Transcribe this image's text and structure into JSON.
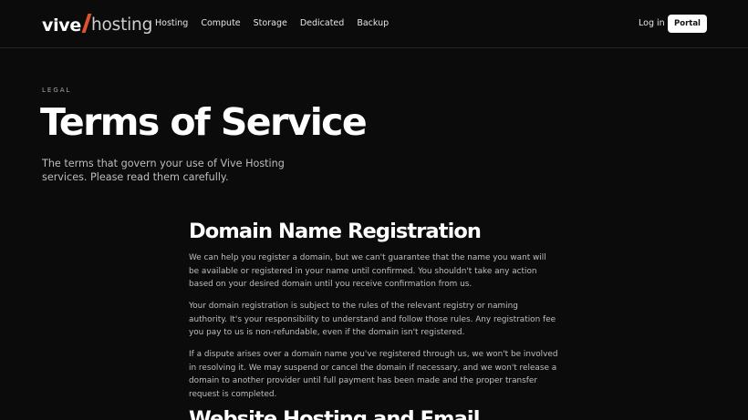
{
  "header": {
    "logo": {
      "part1": "vive",
      "part2": "hosting"
    },
    "nav": [
      "Hosting",
      "Compute",
      "Storage",
      "Dedicated",
      "Backup"
    ],
    "login_label": "Log in",
    "portal_label": "Portal"
  },
  "hero": {
    "eyebrow": "LEGAL",
    "title": "Terms of Service",
    "subtitle": "The terms that govern your use of Vive Hosting services. Please read them carefully."
  },
  "sections": [
    {
      "title": "Domain Name Registration",
      "paragraphs": [
        "We can help you register a domain, but we can't guarantee that the name you want will be available or registered in your name until confirmed. You shouldn't take any action based on your desired domain until you receive confirmation from us.",
        "Your domain registration is subject to the rules of the relevant registry or naming authority. It's your responsibility to understand and follow those rules. Any registration fee you pay to us is non-refundable, even if the domain isn't registered.",
        "If a dispute arises over a domain name you've registered through us, we won't be involved in resolving it. We may suspend or cancel the domain if necessary, and we won't release a domain to another provider until full payment has been made and the proper transfer request is completed."
      ]
    },
    {
      "title": "Website Hosting and Email"
    }
  ]
}
